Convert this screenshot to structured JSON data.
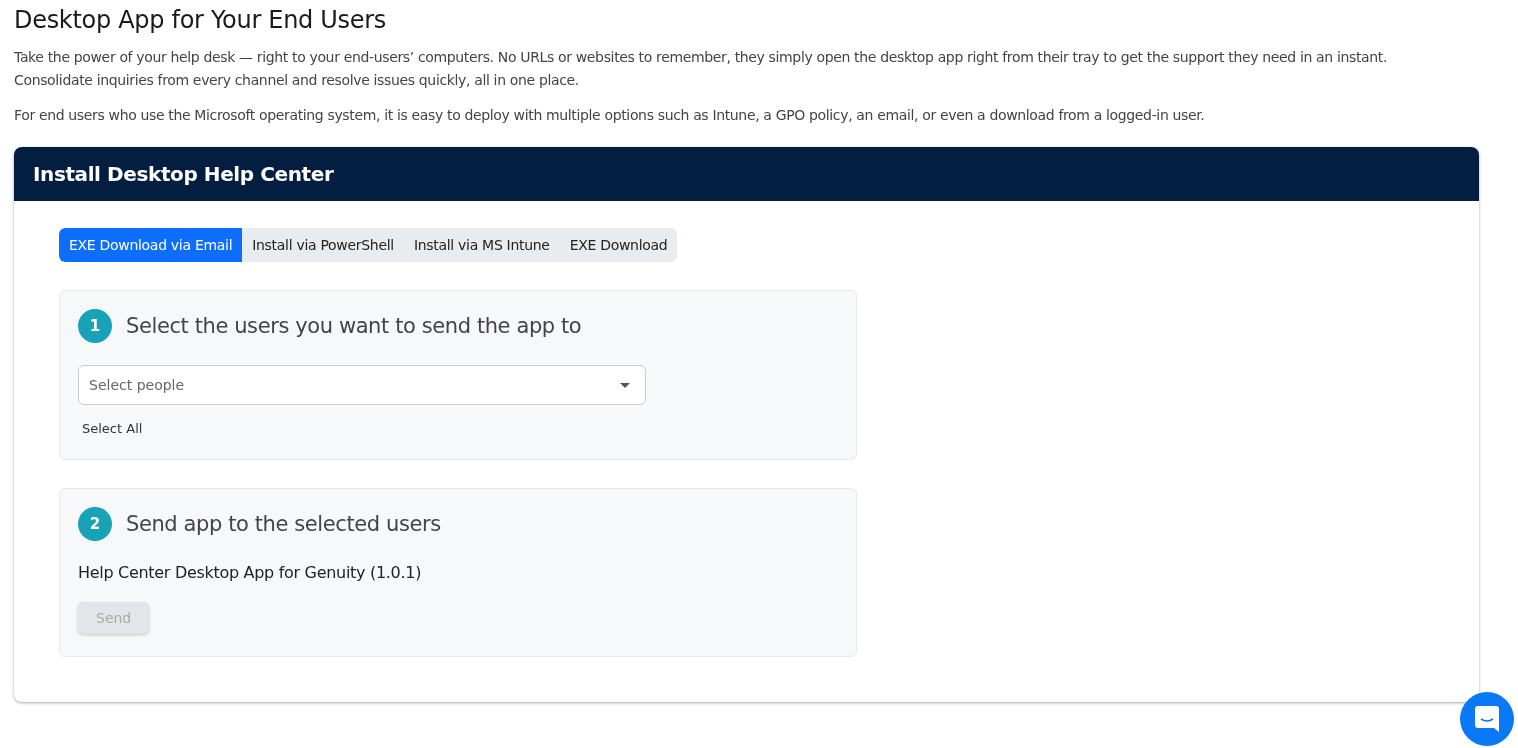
{
  "page": {
    "title": "Desktop App for Your End Users",
    "paragraphs": [
      "Take the power of your help desk — right to your end-users’ computers. No URLs or websites to remember, they simply open the desktop app right from their tray to get the support they need in an instant. Consolidate inquiries from every channel and resolve issues quickly, all in one place.",
      "For end users who use the Microsoft operating system, it is easy to deploy with multiple options such as Intune, a GPO policy, an email, or even a download from a logged-in user."
    ]
  },
  "panel": {
    "title": "Install Desktop Help Center",
    "tabs": [
      {
        "label": "EXE Download via Email",
        "selected": true
      },
      {
        "label": "Install via PowerShell",
        "selected": false
      },
      {
        "label": "Install via MS Intune",
        "selected": false
      },
      {
        "label": "EXE Download",
        "selected": false
      }
    ],
    "steps": [
      {
        "number": "1",
        "title": "Select the users you want to send the app to",
        "select": {
          "placeholder": "Select people"
        },
        "link": "Select All"
      },
      {
        "number": "2",
        "title": "Send app to the selected users",
        "text": "Help Center Desktop App for Genuity (1.0.1)",
        "button": {
          "label": "Send",
          "disabled": true
        }
      }
    ]
  }
}
